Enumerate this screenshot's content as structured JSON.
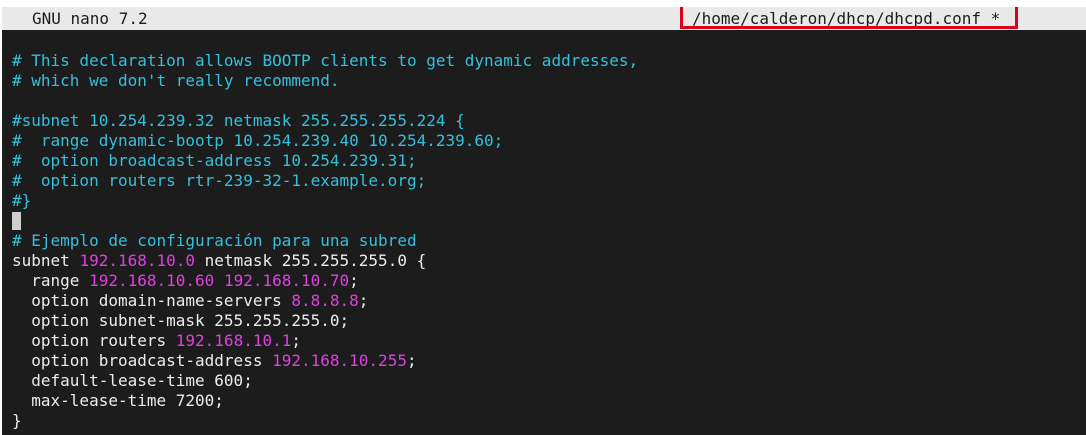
{
  "titlebar": {
    "app": "GNU nano 7.2",
    "filepath": "/home/calderon/dhcp/dhcpd.conf *"
  },
  "editor": {
    "lines": [
      [
        {
          "t": "# This declaration allows BOOTP clients to get dynamic addresses,",
          "c": "comment"
        }
      ],
      [
        {
          "t": "# which we don't really recommend.",
          "c": "comment"
        }
      ],
      [],
      [
        {
          "t": "#subnet 10.254.239.32 netmask 255.255.255.224 {",
          "c": "comment"
        }
      ],
      [
        {
          "t": "#  range dynamic-bootp 10.254.239.40 10.254.239.60;",
          "c": "comment"
        }
      ],
      [
        {
          "t": "#  option broadcast-address 10.254.239.31;",
          "c": "comment"
        }
      ],
      [
        {
          "t": "#  option routers rtr-239-32-1.example.org;",
          "c": "comment"
        }
      ],
      [
        {
          "t": "#}",
          "c": "comment"
        }
      ],
      [
        {
          "cursor": true
        }
      ],
      [
        {
          "t": "# Ejemplo de configuración para una subred",
          "c": "comment"
        }
      ],
      [
        {
          "t": "subnet ",
          "c": "plain"
        },
        {
          "t": "192.168.10.0",
          "c": "number"
        },
        {
          "t": " netmask 255.255.255.0 {",
          "c": "plain"
        }
      ],
      [
        {
          "t": "  range ",
          "c": "plain"
        },
        {
          "t": "192.168.10.60",
          "c": "number"
        },
        {
          "t": " ",
          "c": "plain"
        },
        {
          "t": "192.168.10.70",
          "c": "number"
        },
        {
          "t": ";",
          "c": "plain"
        }
      ],
      [
        {
          "t": "  option domain-name-servers ",
          "c": "plain"
        },
        {
          "t": "8.8.8.8",
          "c": "number"
        },
        {
          "t": ";",
          "c": "plain"
        }
      ],
      [
        {
          "t": "  option subnet-mask 255.255.255.0;",
          "c": "plain"
        }
      ],
      [
        {
          "t": "  option routers ",
          "c": "plain"
        },
        {
          "t": "192.168.10.1",
          "c": "number"
        },
        {
          "t": ";",
          "c": "plain"
        }
      ],
      [
        {
          "t": "  option broadcast-address ",
          "c": "plain"
        },
        {
          "t": "192.168.10.255",
          "c": "number"
        },
        {
          "t": ";",
          "c": "plain"
        }
      ],
      [
        {
          "t": "  default-lease-time 600;",
          "c": "plain"
        }
      ],
      [
        {
          "t": "  max-lease-time 7200;",
          "c": "plain"
        }
      ],
      [
        {
          "t": "}",
          "c": "plain"
        }
      ]
    ]
  },
  "colors": {
    "background": "#1c1c1c",
    "titlebar": "#e9e9e9",
    "comment": "#34c0dd",
    "ip_literal": "#e040e0",
    "text": "#ececec",
    "highlight_box": "#d9001a"
  }
}
